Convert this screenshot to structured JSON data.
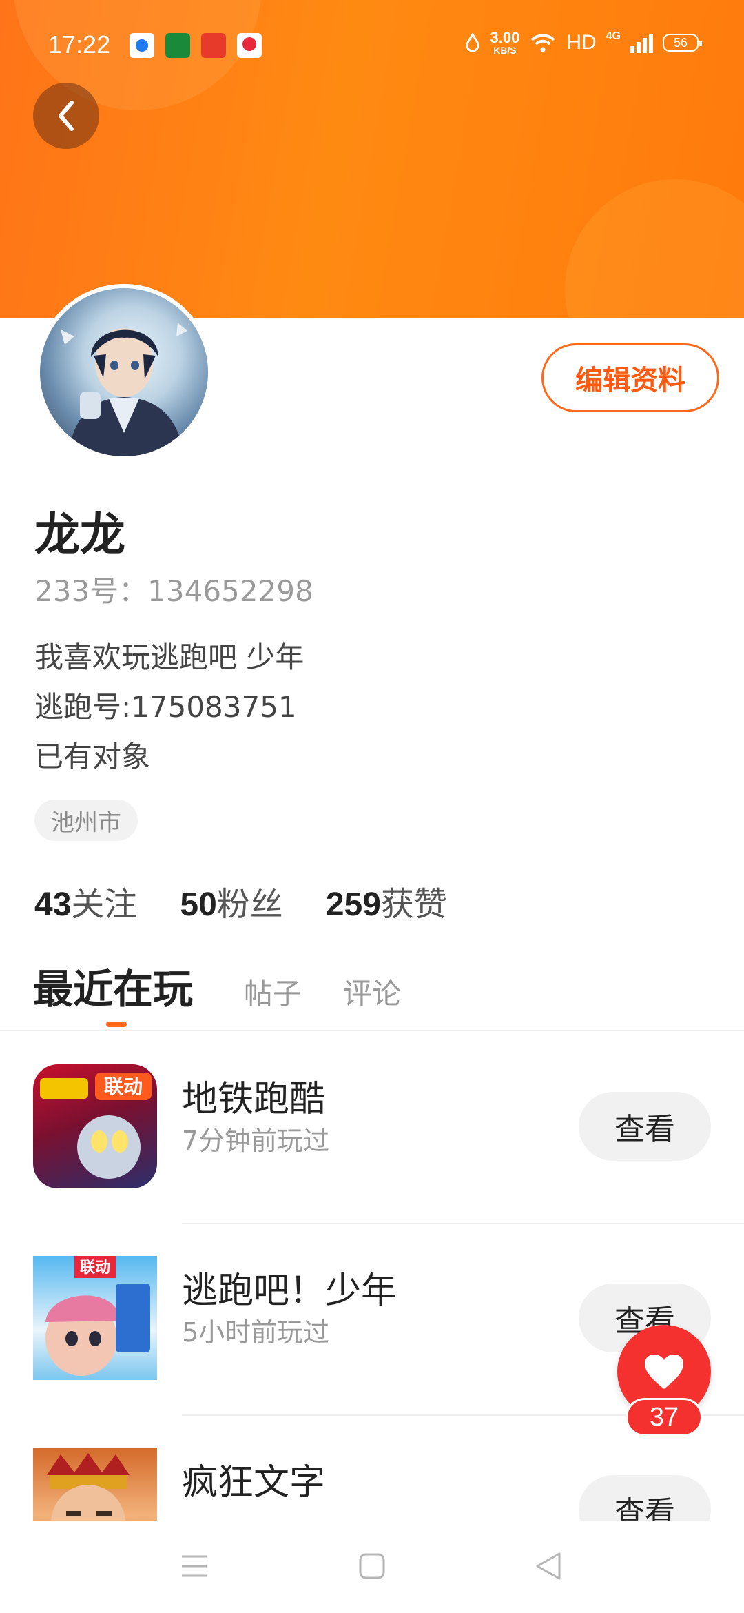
{
  "status_bar": {
    "time": "17:22",
    "net_speed_value": "3.00",
    "net_speed_unit": "KB/S",
    "hd_label": "HD",
    "network_type": "4G",
    "battery": "56"
  },
  "profile": {
    "edit_label": "编辑资料",
    "nickname": "龙龙",
    "uid_text": "233号：134652298",
    "bio_lines": [
      "我喜欢玩逃跑吧 少年",
      "逃跑号:175083751",
      "已有对象"
    ],
    "location": "池州市"
  },
  "stats": [
    {
      "value": "43",
      "label": "关注"
    },
    {
      "value": "50",
      "label": "粉丝"
    },
    {
      "value": "259",
      "label": "获赞"
    }
  ],
  "tabs": [
    {
      "label": "最近在玩",
      "active": true
    },
    {
      "label": "帖子",
      "active": false
    },
    {
      "label": "评论",
      "active": false
    }
  ],
  "games": [
    {
      "title": "地铁跑酷",
      "subtitle": "7分钟前玩过",
      "button": "查看",
      "badge": "联动",
      "icon": "subway-surfers-icon"
    },
    {
      "title": "逃跑吧！少年",
      "subtitle": "5小时前玩过",
      "button": "查看",
      "badge": "联动",
      "icon": "escape-boy-icon"
    },
    {
      "title": "疯狂文字",
      "subtitle": "",
      "button": "查看",
      "icon": "crazy-words-icon"
    }
  ],
  "like": {
    "count": "37"
  },
  "colors": {
    "brand_orange": "#ff7a12",
    "accent": "#ff5a10",
    "like_red": "#f4312f"
  }
}
